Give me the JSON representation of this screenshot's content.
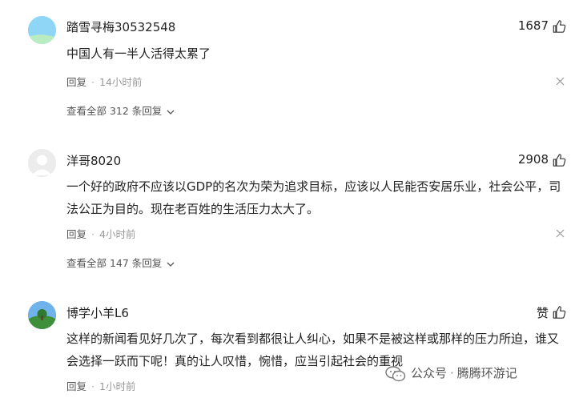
{
  "comments": [
    {
      "username": "踏雪寻梅30532548",
      "likes": "1687",
      "text": "中国人有一半人活得太累了",
      "reply_label": "回复",
      "time": "14小时前",
      "view_replies": "查看全部 312 条回复"
    },
    {
      "username": "洋哥8020",
      "likes": "2908",
      "text": "一个好的政府不应该以GDP的名次为荣为追求目标，应该以人民能否安居乐业，社会公平，司法公正为目的。现在老百姓的生活压力太大了。",
      "reply_label": "回复",
      "time": "4小时前",
      "view_replies": "查看全部 147 条回复"
    },
    {
      "username": "博学小羊L6",
      "likes": "赞",
      "text": "这样的新闻看见好几次了，每次看到都很让人纠心，如果不是被这样或那样的压力所迫，谁又会选择一跃而下呢！真的让人叹惜，惋惜，应当引起社会的重视",
      "reply_label": "回复",
      "time": "1小时前"
    }
  ],
  "watermark": {
    "prefix": "公众号",
    "separator": "·",
    "name": "腾腾环游记"
  }
}
